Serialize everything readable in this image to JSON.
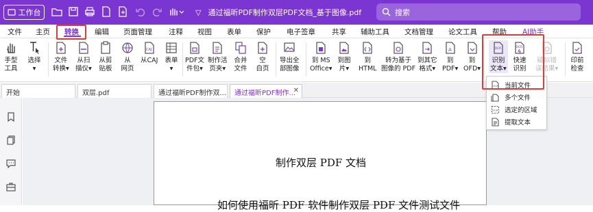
{
  "title_bar": {
    "workspace_label": "工作台",
    "document_title": "通过福昕PDF制作双层PDF文档_基于图像.pdf",
    "search_placeholder": "搜索"
  },
  "menu": {
    "items": [
      "文件",
      "主页",
      "转换",
      "编辑",
      "页面管理",
      "注释",
      "视图",
      "表单",
      "保护",
      "电子签章",
      "共享",
      "辅助工具",
      "文档管理",
      "论文工具",
      "帮助",
      "AI助手"
    ],
    "active": "转换"
  },
  "ribbon": {
    "tools": [
      {
        "l1": "手型",
        "l2": "工具",
        "icon": "hand-icon"
      },
      {
        "l1": "选择",
        "l2": "▾",
        "icon": "cursor-icon"
      },
      {
        "l1": "文件",
        "l2": "转换▾",
        "icon": "file-convert-icon"
      },
      {
        "l1": "从扫",
        "l2": "描仪▾",
        "icon": "scanner-icon"
      },
      {
        "l1": "从剪",
        "l2": "贴板",
        "icon": "clipboard-icon"
      },
      {
        "l1": "从",
        "l2": "网页",
        "icon": "web-icon"
      },
      {
        "l1": "从CAJ",
        "l2": "",
        "icon": "caj-icon"
      },
      {
        "l1": "表单",
        "l2": "▾",
        "icon": "form-icon"
      },
      {
        "l1": "PDF文",
        "l2": "件包▾",
        "icon": "portfolio-icon"
      },
      {
        "l1": "制作活",
        "l2": "页夹▾",
        "icon": "binder-icon"
      },
      {
        "l1": "合并",
        "l2": "文件",
        "icon": "merge-icon"
      },
      {
        "l1": "空",
        "l2": "白页",
        "icon": "blank-page-icon"
      },
      {
        "l1": "导出全",
        "l2": "部图像",
        "icon": "export-images-icon"
      },
      {
        "l1": "到 MS",
        "l2": "Office▾",
        "icon": "to-office-icon"
      },
      {
        "l1": "到图",
        "l2": "片▾",
        "icon": "to-image-icon"
      },
      {
        "l1": "到",
        "l2": "HTML",
        "icon": "to-html-icon"
      },
      {
        "l1": "转为基于",
        "l2": "图像的 PDF",
        "icon": "image-pdf-icon"
      },
      {
        "l1": "到其它",
        "l2": "格式▾",
        "icon": "to-other-icon"
      },
      {
        "l1": "到",
        "l2": "PDF▾",
        "icon": "to-pdfa-icon"
      },
      {
        "l1": "到",
        "l2": "OFD▾",
        "icon": "to-ofd-icon"
      },
      {
        "l1": "识别",
        "l2": "文本▾",
        "icon": "ocr-icon"
      },
      {
        "l1": "快速",
        "l2": "识别",
        "icon": "quick-ocr-icon"
      },
      {
        "l1": "疑似错",
        "l2": "误结果▾",
        "icon": "suspect-icon"
      },
      {
        "l1": "印前",
        "l2": "检查",
        "icon": "preflight-icon"
      }
    ]
  },
  "tabs": [
    {
      "label": "开始"
    },
    {
      "label": "双层.pdf"
    },
    {
      "label": "通过福昕PDF制作双..."
    },
    {
      "label": "通过福昕PDF制作..."
    }
  ],
  "ocr_menu": {
    "items": [
      {
        "label": "当前文件",
        "icon": "current-file-icon"
      },
      {
        "label": "多个文件",
        "icon": "multiple-files-icon"
      },
      {
        "label": "选定的区域",
        "icon": "selected-area-icon"
      },
      {
        "label": "提取文本",
        "icon": "extract-text-icon"
      }
    ]
  },
  "document": {
    "heading": "制作双层 PDF 文档",
    "body_line": "如何使用福昕 PDF 软件制作双层 PDF 文件测试文件"
  },
  "colors": {
    "accent": "#7b35d0",
    "highlight": "#e53935"
  }
}
